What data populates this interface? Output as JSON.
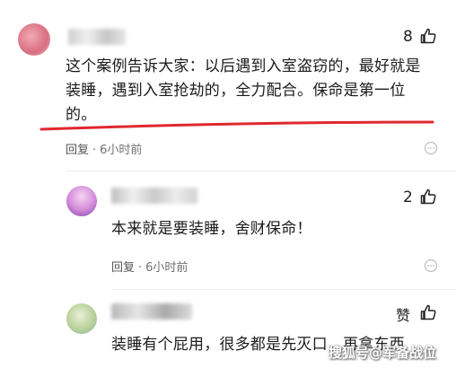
{
  "comments": [
    {
      "likes": "8",
      "text_lines": [
        "这个案例告诉大家：以后遇到入室盗窃的，最好就是",
        "装睡，遇到入室抢劫的，全力配合。保命是第一位",
        "的。"
      ],
      "reply_label": "回复",
      "dot": "·",
      "time": "6小时前"
    },
    {
      "likes": "2",
      "text": "本来就是要装睡，舍财保命！",
      "reply_label": "回复",
      "dot": "·",
      "time": "6小时前"
    },
    {
      "likes": "赞",
      "text": "装睡有个屁用，很多都是先灭口，再拿东西"
    }
  ],
  "watermark": "搜狐号@军备战位"
}
